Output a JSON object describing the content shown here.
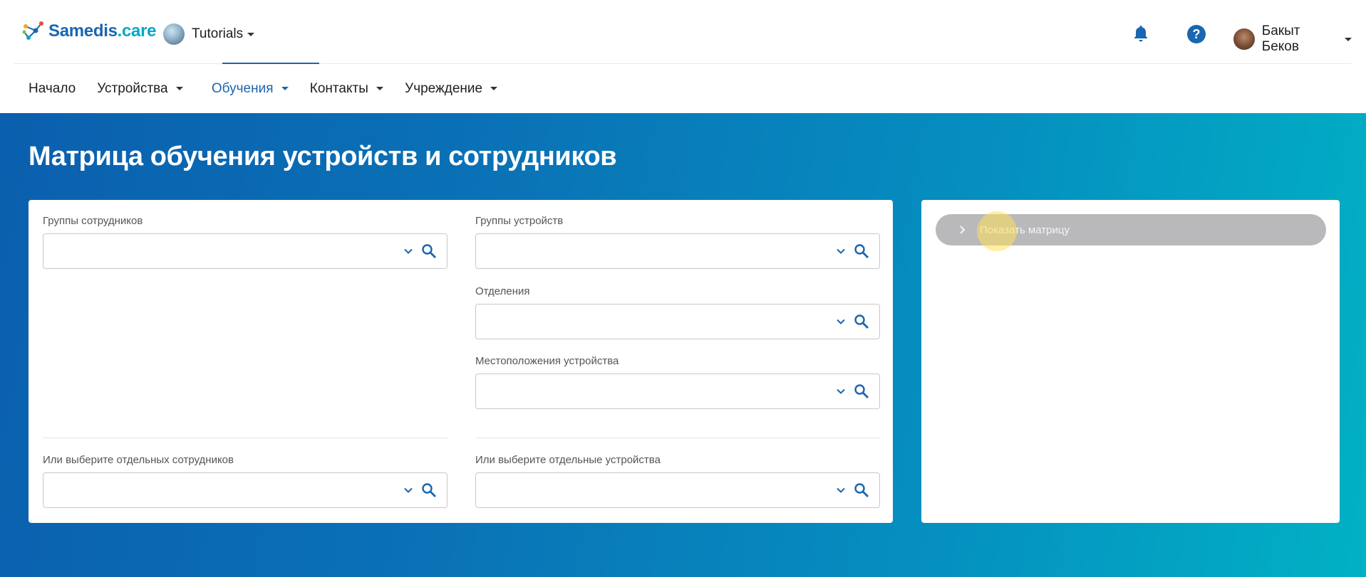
{
  "header": {
    "logo_text_main": "Samedis",
    "logo_text_suffix": ".care",
    "tenant_label": "Tutorials",
    "user_name": "Бакыт Беков",
    "help_glyph": "?"
  },
  "nav": {
    "items": [
      {
        "label": "Начало",
        "has_dropdown": false
      },
      {
        "label": "Устройства",
        "has_dropdown": true
      },
      {
        "label": "Обучения",
        "has_dropdown": true,
        "active": true
      },
      {
        "label": "Контакты",
        "has_dropdown": true
      },
      {
        "label": "Учреждение",
        "has_dropdown": true
      }
    ]
  },
  "page": {
    "title": "Матрица обучения устройств и сотрудников"
  },
  "filters": {
    "employee_groups": {
      "label": "Группы сотрудников",
      "value": ""
    },
    "device_groups": {
      "label": "Группы устройств",
      "value": ""
    },
    "departments": {
      "label": "Отделения",
      "value": ""
    },
    "device_locations": {
      "label": "Местоположения устройства",
      "value": ""
    },
    "individual_employees": {
      "label": "Или выберите отдельных сотрудников",
      "value": ""
    },
    "individual_devices": {
      "label": "Или выберите отдельные устройства",
      "value": ""
    }
  },
  "actions": {
    "show_matrix_label": "Показать матрицу",
    "show_matrix_enabled": false
  },
  "colors": {
    "brand_blue": "#1a66b0",
    "brand_cyan": "#00a8c6",
    "hero_gradient_start": "#0b5fae",
    "hero_gradient_end": "#01b1c4",
    "disabled_button": "#b9b9bb"
  },
  "icons": [
    "logo-icon",
    "tenant-avatar",
    "bell-icon",
    "help-icon",
    "user-avatar",
    "chevron-down-icon",
    "search-icon",
    "chevron-right-icon"
  ]
}
